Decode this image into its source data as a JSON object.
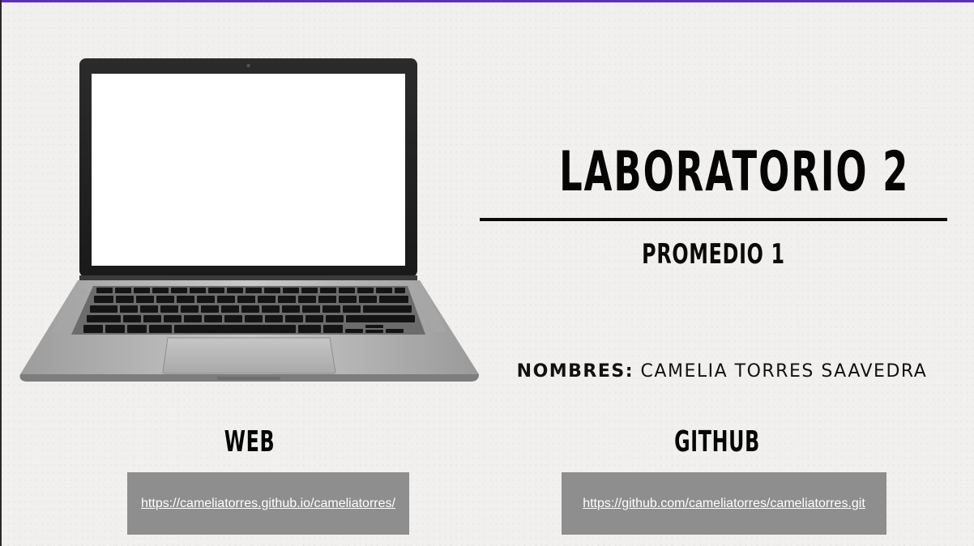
{
  "header": {
    "title": "LABORATORIO 2",
    "subtitle": "PROMEDIO 1"
  },
  "author": {
    "label": "NOMBRES:",
    "name": "CAMELIA TORRES SAAVEDRA"
  },
  "links": {
    "web": {
      "label": "WEB",
      "url": "https://cameliatorres.github.io/cameliatorres/"
    },
    "github": {
      "label": "GITHUB",
      "url": "https://github.com/cameliatorres/cameliatorres.git"
    }
  },
  "colors": {
    "background": "#f1f0ee",
    "accent_bar": "#5b2fc4",
    "link_box": "#8f8e8e",
    "text": "#050505"
  },
  "illustration": {
    "name": "laptop-icon"
  }
}
